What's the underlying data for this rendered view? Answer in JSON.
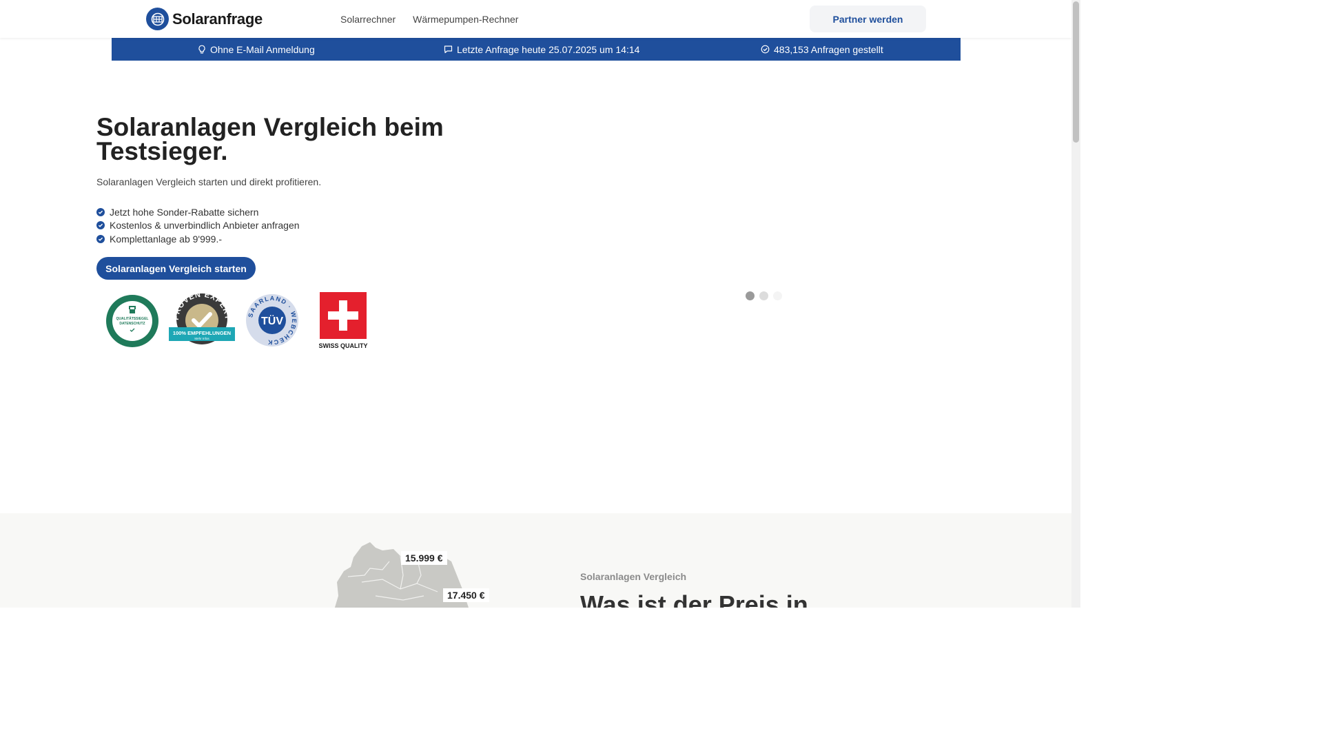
{
  "header": {
    "logo_text": "Solaranfrage",
    "nav": [
      {
        "label": "Solarrechner"
      },
      {
        "label": "Wärmepumpen-Rechner"
      }
    ],
    "partner_label": "Partner werden"
  },
  "infobar": {
    "items": [
      {
        "icon": "bulb-icon",
        "text": "Ohne E-Mail Anmeldung"
      },
      {
        "icon": "chat-icon",
        "text": "Letzte Anfrage heute 25.07.2025 um 14:14"
      },
      {
        "icon": "check-circle-icon",
        "text": "483,153 Anfragen gestellt"
      }
    ]
  },
  "hero": {
    "title": "Solaranlagen Vergleich beim Testsieger.",
    "subtitle": "Solaranlagen Vergleich starten und direkt profitieren.",
    "bullets": [
      "Jetzt hohe Sonder-Rabatte sichern",
      "Kostenlos & unverbindlich Anbieter anfragen",
      "Komplettanlage ab 9'999.-"
    ],
    "cta_label": "Solaranlagen Vergleich starten"
  },
  "badges": {
    "datenschutz": {
      "line1": "QUALITÄTSSIEGEL",
      "line2": "DATENSCHUTZ"
    },
    "proven_expert": {
      "ring": "PROVEN EXPERT",
      "ribbon": "100% EMPFEHLUNGEN",
      "sub": "Mehr Infos"
    },
    "tuev": {
      "center": "TÜV",
      "ring": "SAARLAND · WEBCHECK"
    },
    "swiss": {
      "caption": "SWISS QUALITY"
    }
  },
  "carousel": {
    "slide_count": 3,
    "active_index": 0
  },
  "lower": {
    "price_tags": [
      "15.999 €",
      "17.450 €"
    ],
    "eyebrow": "Solaranlagen Vergleich",
    "heading": "Was ist der Preis in"
  },
  "colors": {
    "brand": "#1f4f9c",
    "proven_expert_teal": "#1ea7b5",
    "datenschutz_green": "#1f7a5a",
    "swiss_red": "#e4202d"
  }
}
